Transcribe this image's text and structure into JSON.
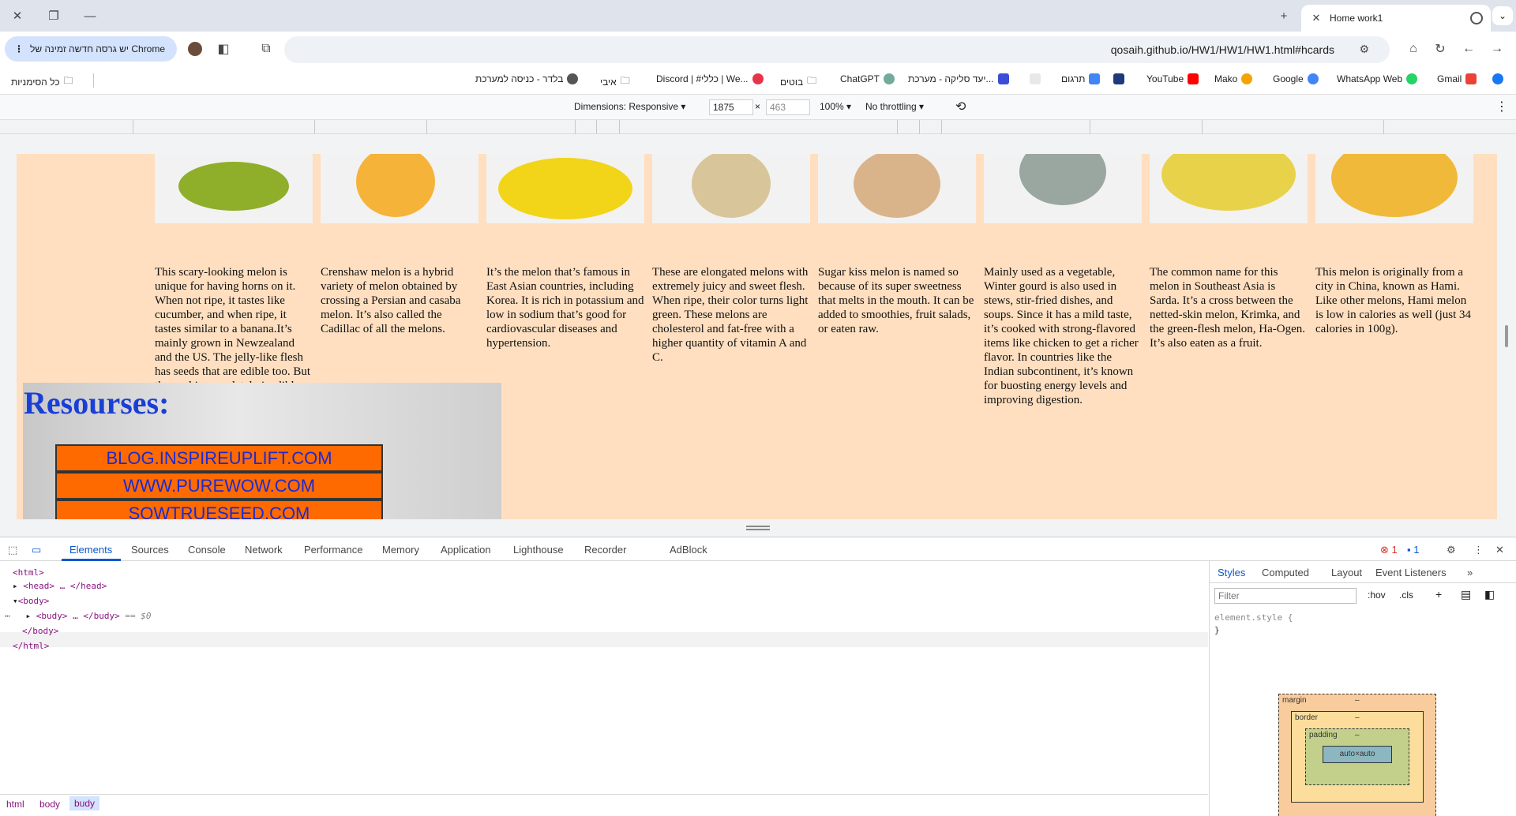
{
  "browser": {
    "tab": {
      "title": "Home work1"
    },
    "update_chip": "יש גרסה חדשה זמינה של Chrome",
    "url": "qosaih.github.io/HW1/HW1/HW1.html#hcards",
    "bookmarks": [
      "Gmail",
      "WhatsApp Web",
      "Google",
      "Mako",
      "YouTube",
      "תרגום",
      "יעד סליקה - מערכת...",
      "ChatGPT",
      "בוטים",
      "Discord | #כללי | We...",
      "איבי",
      "בלדר - כניסה למערכת",
      "כל הסימניות"
    ]
  },
  "device_toolbar": {
    "dimensions_label": "Dimensions: Responsive",
    "width": "1875",
    "height": "463",
    "zoom": "100%",
    "throttling": "No throttling"
  },
  "page": {
    "melons": [
      {
        "name": "kiwano",
        "color": "#8fae2a",
        "desc": "This scary-looking melon is unique for having horns on it. When not ripe, it tastes like cucumber, and when ripe, it tastes similar to a banana.It’s mainly grown in Newzealand and the US. The jelly-like flesh has seeds that are edible too. But the peel is completely inedible."
      },
      {
        "name": "crenshaw",
        "color": "#f5b33a",
        "desc": "Crenshaw melon is a hybrid variety of melon obtained by crossing a Persian and casaba melon. It’s also called the Cadillac of all the melons."
      },
      {
        "name": "korean",
        "color": "#f2d418",
        "desc": "It’s the melon that’s famous in East Asian countries, including Korea. It is rich in potassium and low in sodium that’s good for cardiovascular diseases and hypertension."
      },
      {
        "name": "elongated",
        "color": "#d8c59a",
        "desc": "These are elongated melons with extremely juicy and sweet flesh. When ripe, their color turns light green. These melons are cholesterol and fat-free with a higher quantity of vitamin A and C."
      },
      {
        "name": "sugar-kiss",
        "color": "#d9b48a",
        "desc": "Sugar kiss melon is named so because of its super sweetness that melts in the mouth. It can be added to smoothies, fruit salads, or eaten raw."
      },
      {
        "name": "winter-gourd",
        "color": "#9aa7a0",
        "desc": "Mainly used as a vegetable, Winter gourd is also used in stews, stir-fried dishes, and soups. Since it has a mild taste, it’s cooked with strong-flavored items like chicken to get a richer flavor. In countries like the Indian subcontinent, it’s known for buosting energy levels and improving digestion."
      },
      {
        "name": "sarda",
        "color": "#e8d24a",
        "desc": "The common name for this melon in Southeast Asia is Sarda. It’s a cross between the netted-skin melon, Krimka, and the green-flesh melon, Ha-Ogen. It’s also eaten as a fruit."
      },
      {
        "name": "hami",
        "color": "#f0b93a",
        "desc": "This melon is originally from a city in China, known as Hami. Like other melons, Hami melon is low in calories as well (just 34 calories in 100g)."
      }
    ],
    "resources_title": "Resourses:",
    "resources": [
      "BLOG.INSPIREUPLIFT.COM",
      "WWW.PUREWOW.COM",
      "SOWTRUESEED.COM"
    ]
  },
  "devtools": {
    "tabs": [
      "Elements",
      "Sources",
      "Console",
      "Network",
      "Performance",
      "Memory",
      "Application",
      "Lighthouse",
      "Recorder",
      "AdBlock"
    ],
    "dom": {
      "html_open": "<html>",
      "head": "<head> … </head>",
      "body_open": "<body>",
      "budy": "<budy> … </budy>",
      "selected_marker": "== $0",
      "body_close": "</body>",
      "html_close": "</html>"
    },
    "breadcrumbs": [
      "html",
      "body",
      "budy"
    ],
    "errors_count": "1",
    "messages_count": "1",
    "styles_tabs": [
      "Styles",
      "Computed",
      "Layout",
      "Event Listeners"
    ],
    "filter_placeholder": "Filter",
    "hov": ":hov",
    "cls": ".cls",
    "element_style": "element.style {",
    "element_style_close": "}",
    "boxmodel": {
      "margin": "margin",
      "border": "border",
      "padding": "padding",
      "content": "auto×auto",
      "dash": "–"
    }
  }
}
